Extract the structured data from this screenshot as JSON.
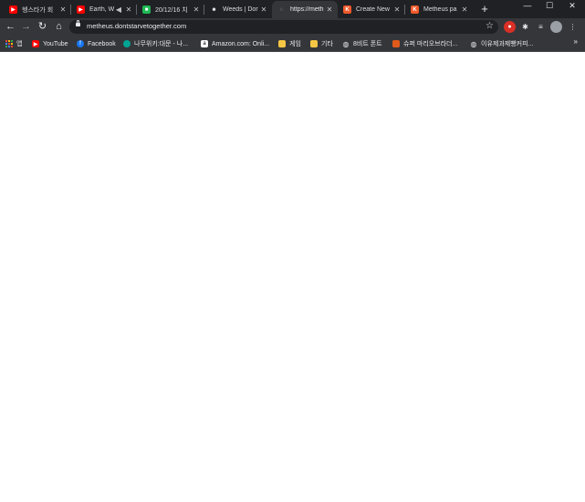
{
  "tabs": [
    {
      "title": "헹스타가 회",
      "icon": "youtube-icon",
      "color": "#ff0000"
    },
    {
      "title": "Earth, W",
      "icon": "youtube-icon",
      "color": "#ff0000",
      "audio": "speaker-icon"
    },
    {
      "title": "20/12/16 치",
      "icon": "green-square-icon",
      "color": "#1db954"
    },
    {
      "title": "Weeds | Dor",
      "icon": "dst-head-icon",
      "color": "#3c3c3c"
    },
    {
      "title": "https://meth",
      "icon": "loading-icon",
      "color": "#5f6368"
    },
    {
      "title": "Create New",
      "icon": "k-icon",
      "color": "#f2592a"
    },
    {
      "title": "Metheus pa",
      "icon": "k-icon",
      "color": "#f2592a"
    }
  ],
  "toolbar": {
    "url": "metheus.dontstarvetogether.com",
    "back": "←",
    "forward": "→",
    "reload": "↻",
    "home": "⌂",
    "star": "☆",
    "newtab": "+"
  },
  "window": {
    "minimize": "—",
    "maximize": "☐",
    "close": "✕"
  },
  "bookmarks": [
    {
      "label": "앱",
      "icon": "apps-grid-icon"
    },
    {
      "label": "YouTube",
      "icon": "youtube-icon",
      "color": "#ff0000"
    },
    {
      "label": "Facebook",
      "icon": "facebook-icon",
      "color": "#1877f2"
    },
    {
      "label": "나무위키:대문 - 나...",
      "icon": "namuwiki-icon",
      "color": "#00a495"
    },
    {
      "label": "Amazon.com: Onli...",
      "icon": "amazon-icon",
      "color": "#ffffff"
    },
    {
      "label": "게임",
      "icon": "folder-icon",
      "color": "#f6c744"
    },
    {
      "label": "기타",
      "icon": "folder-icon",
      "color": "#f6c744"
    },
    {
      "label": "8비트 폰트",
      "icon": "globe-icon",
      "color": "#e8eaed"
    },
    {
      "label": "슈퍼 마리오브라더...",
      "icon": "mario-icon",
      "color": "#e05a1b"
    },
    {
      "label": "이유제과제빵커피...",
      "icon": "globe-icon",
      "color": "#e8eaed"
    }
  ],
  "bookmarks_more": "»"
}
